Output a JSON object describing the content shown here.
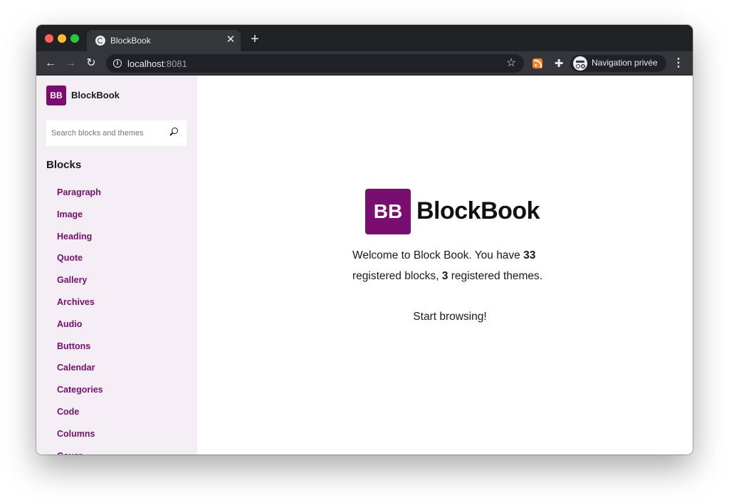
{
  "browser": {
    "tab_title": "BlockBook",
    "tab_close": "✕",
    "new_tab": "+",
    "url_host": "localhost",
    "url_port": ":8081",
    "profile_label": "Navigation privée",
    "colors": {
      "frame": "#202124",
      "toolbar": "#35363a",
      "text": "#e8eaed"
    }
  },
  "sidebar": {
    "brand_badge": "BB",
    "brand_name": "BlockBook",
    "search_placeholder": "Search blocks and themes",
    "section_title": "Blocks",
    "items": [
      {
        "label": "Paragraph"
      },
      {
        "label": "Image"
      },
      {
        "label": "Heading"
      },
      {
        "label": "Quote"
      },
      {
        "label": "Gallery"
      },
      {
        "label": "Archives"
      },
      {
        "label": "Audio"
      },
      {
        "label": "Buttons"
      },
      {
        "label": "Calendar"
      },
      {
        "label": "Categories"
      },
      {
        "label": "Code"
      },
      {
        "label": "Columns"
      },
      {
        "label": "Cover"
      }
    ]
  },
  "main": {
    "hero_badge": "BB",
    "hero_name": "BlockBook",
    "welcome_prefix": "Welcome to Block Book. You have ",
    "block_count": "33",
    "welcome_middle": " registered blocks, ",
    "theme_count": "3",
    "welcome_suffix": " registered themes.",
    "start_text": "Start browsing!"
  },
  "colors": {
    "accent": "#7a0e70",
    "sidebar_bg": "#f2eef4"
  }
}
